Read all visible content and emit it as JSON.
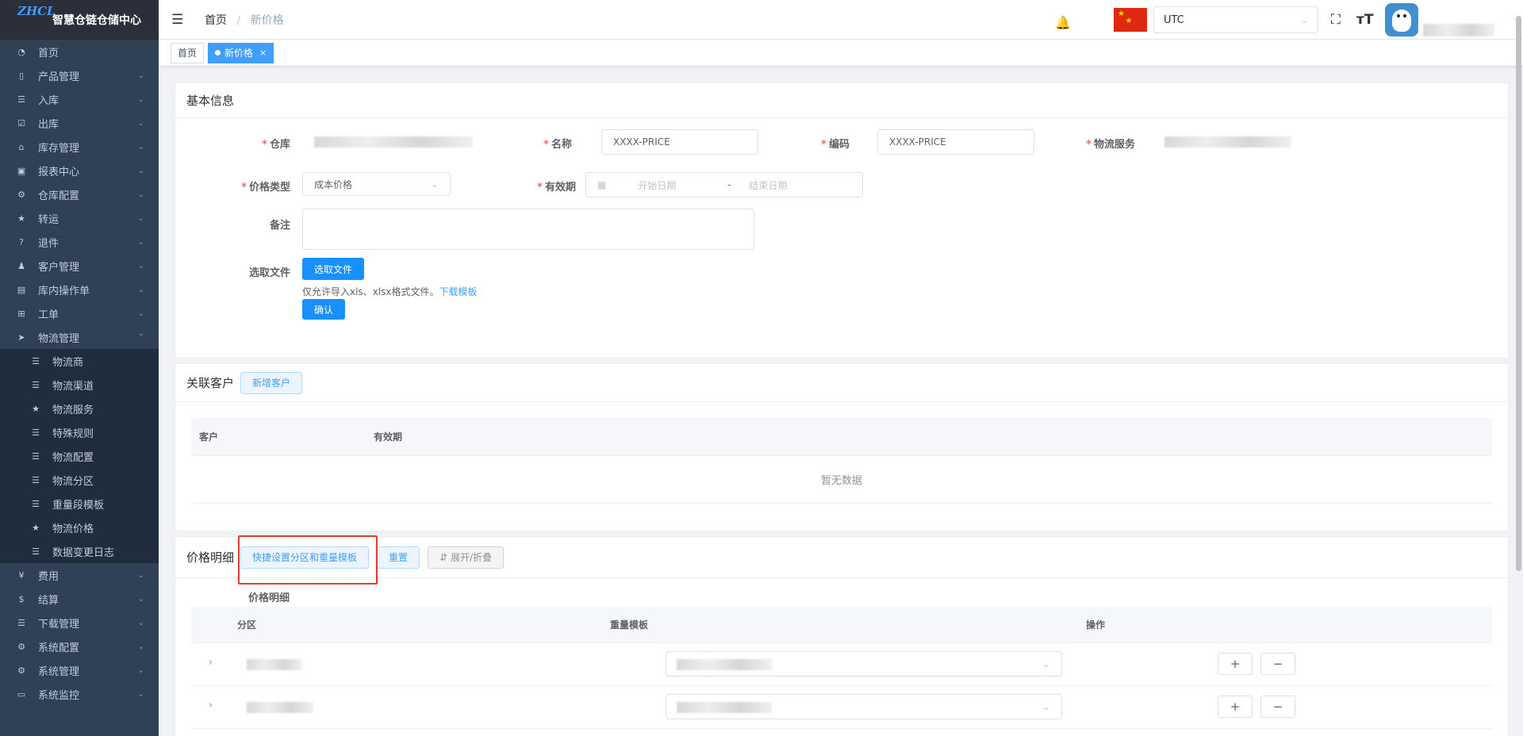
{
  "app": {
    "title": "智慧仓链仓储中心",
    "logo_text": "ZHCL"
  },
  "sidebar": {
    "items": [
      {
        "label": "首页",
        "icon": "dashboard-icon"
      },
      {
        "label": "产品管理",
        "icon": "phone-icon",
        "arrow": "⌄"
      },
      {
        "label": "入库",
        "icon": "list-icon",
        "arrow": "⌄"
      },
      {
        "label": "出库",
        "icon": "checkbox-icon",
        "arrow": "⌄"
      },
      {
        "label": "库存管理",
        "icon": "shop-icon",
        "arrow": "⌄"
      },
      {
        "label": "报表中心",
        "icon": "chart-icon",
        "arrow": "⌄"
      },
      {
        "label": "仓库配置",
        "icon": "gear-icon",
        "arrow": "⌄"
      },
      {
        "label": "转运",
        "icon": "star-icon",
        "arrow": "⌄"
      },
      {
        "label": "退件",
        "icon": "question-icon",
        "arrow": "⌄"
      },
      {
        "label": "客户管理",
        "icon": "user-icon",
        "arrow": "⌄"
      },
      {
        "label": "库内操作单",
        "icon": "doc-icon",
        "arrow": "⌄"
      },
      {
        "label": "工单",
        "icon": "grid-icon",
        "arrow": "⌄"
      },
      {
        "label": "物流管理",
        "icon": "send-icon",
        "arrow": "⌃"
      }
    ],
    "sub_items": [
      {
        "label": "物流商",
        "icon": "list-icon"
      },
      {
        "label": "物流渠道",
        "icon": "list-icon"
      },
      {
        "label": "物流服务",
        "icon": "star-icon"
      },
      {
        "label": "特殊规则",
        "icon": "list-icon"
      },
      {
        "label": "物流配置",
        "icon": "list-icon"
      },
      {
        "label": "物流分区",
        "icon": "list-icon"
      },
      {
        "label": "重量段模板",
        "icon": "list-icon"
      },
      {
        "label": "物流价格",
        "icon": "star-icon"
      },
      {
        "label": "数据变更日志",
        "icon": "list-icon"
      }
    ],
    "items_after": [
      {
        "label": "费用",
        "icon": "yen-icon",
        "arrow": "⌄"
      },
      {
        "label": "结算",
        "icon": "money-icon",
        "arrow": "⌄"
      },
      {
        "label": "下载管理",
        "icon": "list-icon",
        "arrow": "⌄"
      },
      {
        "label": "系统配置",
        "icon": "gear-icon",
        "arrow": "⌄"
      },
      {
        "label": "系统管理",
        "icon": "gear-icon",
        "arrow": "⌄"
      },
      {
        "label": "系统监控",
        "icon": "monitor-icon",
        "arrow": "⌄"
      }
    ]
  },
  "navbar": {
    "breadcrumb_home": "首页",
    "breadcrumb_sep": "/",
    "breadcrumb_current": "新价格",
    "timezone": "UTC"
  },
  "tags": {
    "home": "首页",
    "current": "新价格",
    "close": "×"
  },
  "basic": {
    "title": "基本信息",
    "warehouse_label": "仓库",
    "name_label": "名称",
    "name_value": "XXXX-PRICE",
    "code_label": "编码",
    "code_value": "XXXX-PRICE",
    "service_label": "物流服务",
    "price_type_label": "价格类型",
    "price_type_value": "成本价格",
    "validity_label": "有效期",
    "start_placeholder": "开始日期",
    "range_sep": "-",
    "end_placeholder": "结束日期",
    "remark_label": "备注",
    "file_label": "选取文件",
    "file_button": "选取文件",
    "file_hint": "仅允许导入xls、xlsx格式文件。",
    "download_link": "下载模板",
    "confirm_button": "确认"
  },
  "customers": {
    "title": "关联客户",
    "add_button": "新增客户",
    "col_customer": "客户",
    "col_validity": "有效期",
    "empty": "暂无数据"
  },
  "price": {
    "title": "价格明细",
    "quick_button": "快捷设置分区和重量模板",
    "reset_button": "重置",
    "toggle_button": "展开/折叠",
    "sub_title": "价格明细",
    "col_zone": "分区",
    "col_weight": "重量模板",
    "col_ops": "操作",
    "add_op": "+",
    "remove_op": "−",
    "expand": "›"
  }
}
